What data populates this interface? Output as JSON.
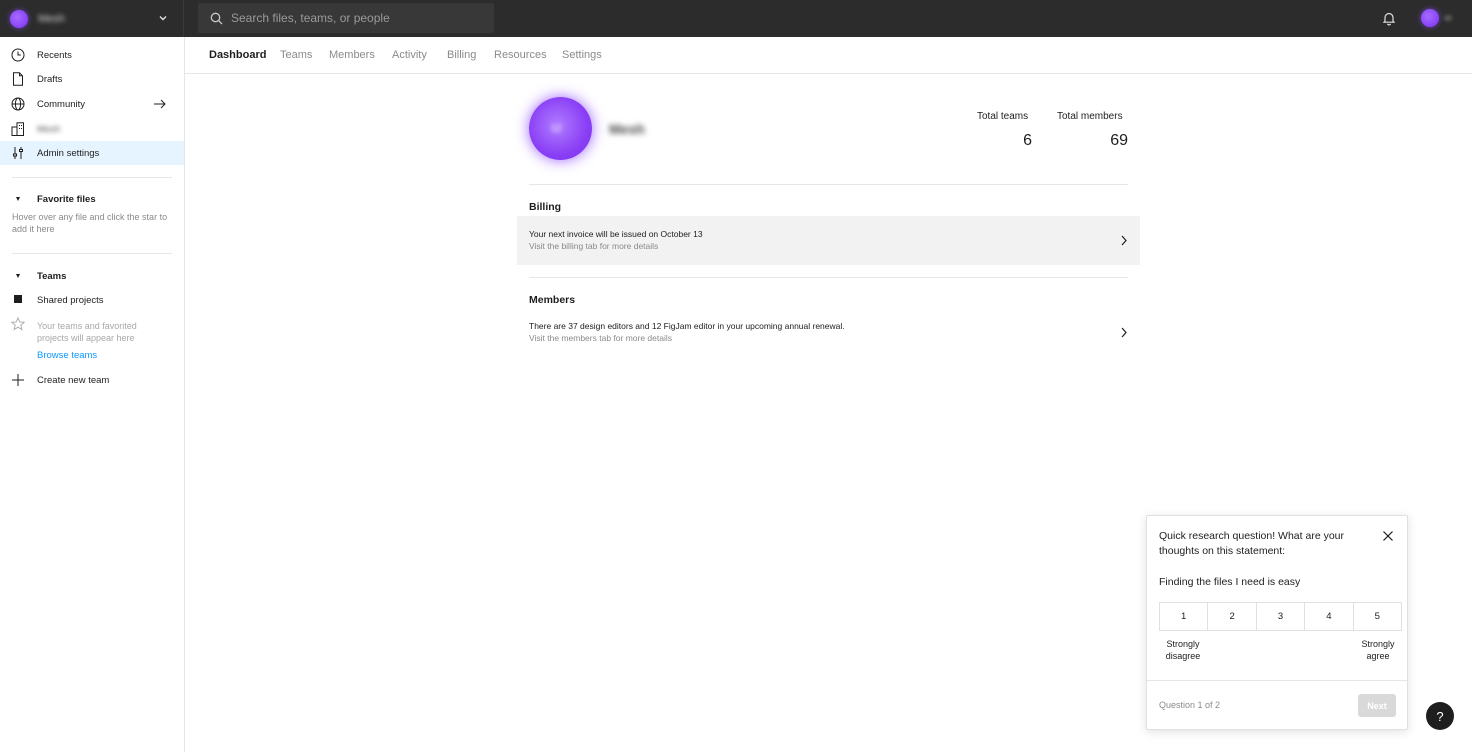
{
  "topbar": {
    "org_name": "Mesh",
    "search_placeholder": "Search files, teams, or people"
  },
  "sidebar": {
    "items": [
      {
        "label": "Recents",
        "icon": "clock-icon"
      },
      {
        "label": "Drafts",
        "icon": "file-icon"
      },
      {
        "label": "Community",
        "icon": "globe-icon"
      },
      {
        "label": "Mesh",
        "icon": "building-icon"
      },
      {
        "label": "Admin settings",
        "icon": "sliders-icon"
      }
    ],
    "favorites": {
      "title": "Favorite files",
      "hint": "Hover over any file and click the star to add it here"
    },
    "teams": {
      "title": "Teams",
      "shared_projects": "Shared projects",
      "hint": "Your teams and favorited projects will appear here",
      "browse": "Browse teams",
      "create": "Create new team"
    }
  },
  "tabs": [
    "Dashboard",
    "Teams",
    "Members",
    "Activity",
    "Billing",
    "Resources",
    "Settings"
  ],
  "main": {
    "org_initial": "M",
    "org_name": "Mesh",
    "stats": {
      "teams_label": "Total teams",
      "teams_value": "6",
      "members_label": "Total members",
      "members_value": "69"
    },
    "billing": {
      "heading": "Billing",
      "line1": "Your next invoice will be issued on October 13",
      "line2": "Visit the billing tab for more details"
    },
    "members": {
      "heading": "Members",
      "line1": "There are 37 design editors and 12 FigJam editor in your upcoming annual renewal.",
      "line2": "Visit the members tab for more details"
    }
  },
  "survey": {
    "question": "Quick research question! What are your thoughts on this statement:",
    "statement": "Finding the files I need is easy",
    "options": [
      "1",
      "2",
      "3",
      "4",
      "5"
    ],
    "low_label": "Strongly disagree",
    "high_label": "Strongly agree",
    "progress": "Question 1 of 2",
    "next_label": "Next"
  },
  "help_label": "?"
}
